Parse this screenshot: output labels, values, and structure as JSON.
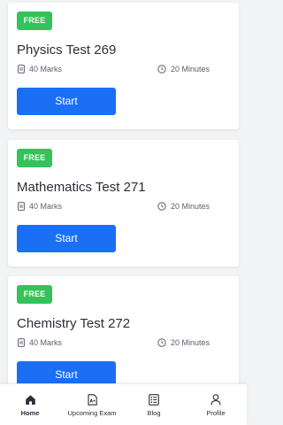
{
  "tests": [
    {
      "badge": "FREE",
      "title": "Physics Test 269",
      "marks": "40 Marks",
      "duration": "20 Minutes",
      "button": "Start"
    },
    {
      "badge": "FREE",
      "title": "Mathematics Test 271",
      "marks": "40 Marks",
      "duration": "20 Minutes",
      "button": "Start"
    },
    {
      "badge": "FREE",
      "title": "Chemistry Test 272",
      "marks": "40 Marks",
      "duration": "20 Minutes",
      "button": "Start"
    }
  ],
  "nav": [
    {
      "label": "Home",
      "icon": "home-icon",
      "active": true
    },
    {
      "label": "Upcoming Exam",
      "icon": "document-icon",
      "active": false
    },
    {
      "label": "Blog",
      "icon": "list-icon",
      "active": false
    },
    {
      "label": "Profile",
      "icon": "user-icon",
      "active": false
    }
  ],
  "colors": {
    "badge": "#34c25a",
    "primary_button": "#1a6ff5",
    "background": "#f2f3f5",
    "text": "#2b2f38"
  }
}
